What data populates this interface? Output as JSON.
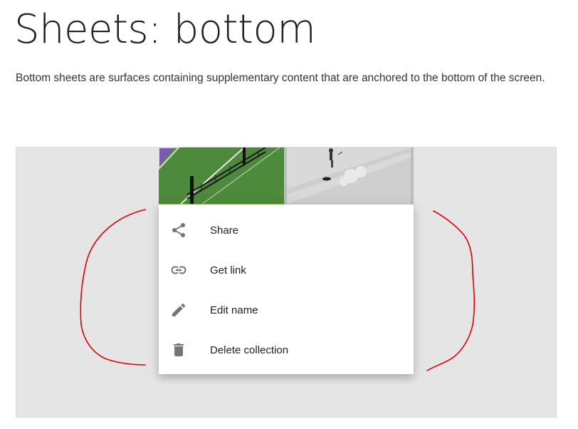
{
  "page": {
    "title": "Sheets: bottom",
    "description": "Bottom sheets are surfaces containing supplementary content that are anchored to the bottom of the screen."
  },
  "bottom_sheet": {
    "items": [
      {
        "label": "Share",
        "icon": "share-icon"
      },
      {
        "label": "Get link",
        "icon": "link-icon"
      },
      {
        "label": "Edit name",
        "icon": "pencil-icon"
      },
      {
        "label": "Delete collection",
        "icon": "trash-icon"
      }
    ]
  },
  "colors": {
    "demo_background": "#e5e5e5",
    "icon_gray": "#757575",
    "annotation_red": "#e00000"
  }
}
